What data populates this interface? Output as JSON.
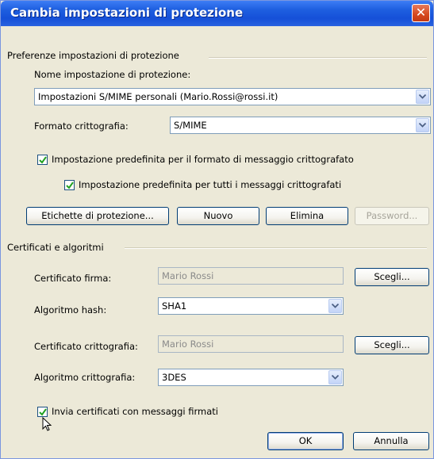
{
  "window": {
    "title": "Cambia impostazioni di protezione",
    "close_glyph": "✕"
  },
  "preferences": {
    "group_label": "Preferenze impostazioni di protezione",
    "name_label": "Nome impostazione di protezione:",
    "name_value": "Impostazioni S/MIME personali (Mario.Rossi@rossi.it)",
    "format_label": "Formato crittografia:",
    "format_value": "S/MIME",
    "checkbox1_label": "Impostazione predefinita per il formato di messaggio crittografato",
    "checkbox1_checked": true,
    "checkbox2_label": "Impostazione predefinita per tutti i messaggi crittografati",
    "checkbox2_checked": true
  },
  "buttons_row": {
    "labels_button": "Etichette di protezione...",
    "new_button": "Nuovo",
    "delete_button": "Elimina",
    "password_button": "Password..."
  },
  "certificates": {
    "group_label": "Certificati e algoritmi",
    "signing_cert_label": "Certificato firma:",
    "signing_cert_value": "Mario Rossi",
    "choose_button": "Scegli...",
    "hash_label": "Algoritmo hash:",
    "hash_value": "SHA1",
    "encryption_cert_label": "Certificato crittografia:",
    "encryption_cert_value": "Mario Rossi",
    "encryption_algo_label": "Algoritmo crittografia:",
    "encryption_algo_value": "3DES",
    "send_certs_label": "Invia certificati con messaggi firmati",
    "send_certs_checked": true
  },
  "footer": {
    "ok_button": "OK",
    "cancel_button": "Annulla"
  },
  "colors": {
    "titlebar": "#1e5fe0",
    "close": "#d6471e",
    "dialog_bg": "#ece9d8",
    "check": "#21a121"
  }
}
